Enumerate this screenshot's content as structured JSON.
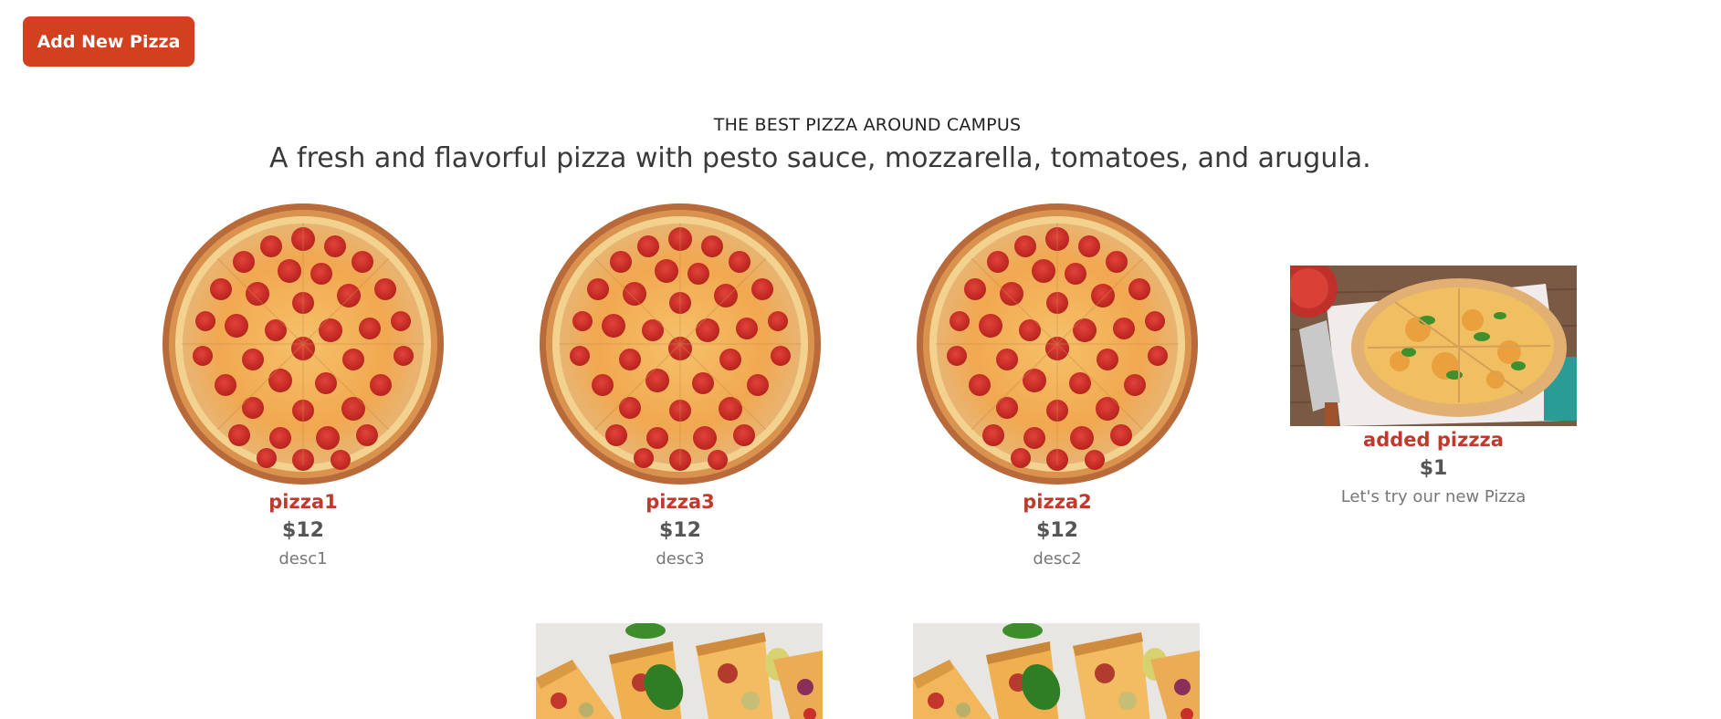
{
  "toolbar": {
    "add_label": "Add New Pizza"
  },
  "hero": {
    "eyebrow": "THE BEST PIZZA AROUND CAMPUS",
    "subtitle": "A fresh and flavorful pizza with pesto sauce, mozzarella, tomatoes, and arugula."
  },
  "pizzas": [
    {
      "name": "pizza1",
      "price": "$12",
      "desc": "desc1"
    },
    {
      "name": "pizza3",
      "price": "$12",
      "desc": "desc3"
    },
    {
      "name": "pizza2",
      "price": "$12",
      "desc": "desc2"
    },
    {
      "name": "added pizzza",
      "price": "$1",
      "desc": "Let's try our new Pizza"
    }
  ],
  "colors": {
    "accent": "#d2401f",
    "name": "#c0392b",
    "price": "#555555",
    "desc": "#777777"
  }
}
